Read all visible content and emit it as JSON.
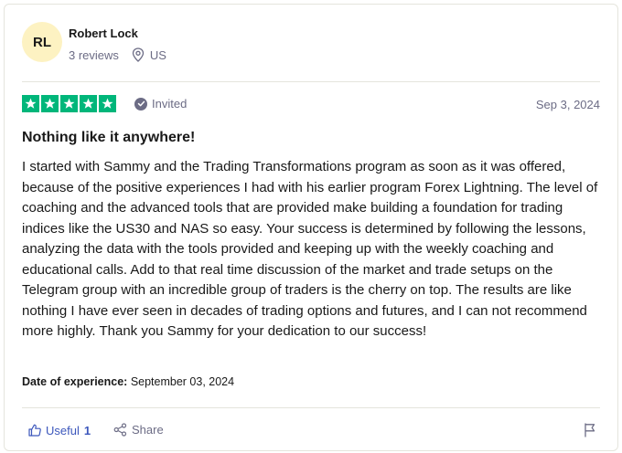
{
  "reviewer": {
    "initials": "RL",
    "name": "Robert Lock",
    "reviews_count": "3 reviews",
    "country": "US",
    "avatar_color": "#fdf2c2"
  },
  "rating": {
    "stars": 5,
    "max_stars": 5,
    "star_color": "#00b67a"
  },
  "badge": {
    "label": "Invited",
    "icon": "check-circle-icon"
  },
  "review": {
    "date": "Sep 3, 2024",
    "title": "Nothing like it anywhere!",
    "body": "I started with Sammy and the Trading Transformations program as soon as it was offered, because of the positive experiences I had with his earlier program Forex Lightning. The level of coaching and the advanced tools that are provided make building a foundation for trading indices like the US30 and NAS so easy. Your success is determined by following the lessons, analyzing the data with the tools provided and keeping up with the weekly coaching and educational calls. Add to that real time discussion of the market and trade setups on the Telegram group with an incredible group of traders is the cherry on top. The results are like nothing I have ever seen in decades of trading options and futures, and I can not recommend more highly. Thank you Sammy for your dedication to our success!",
    "experience_label": "Date of experience:",
    "experience_date": "September 03, 2024"
  },
  "actions": {
    "useful_label": "Useful",
    "useful_count": "1",
    "share_label": "Share",
    "useful_color": "#3c57bc"
  }
}
